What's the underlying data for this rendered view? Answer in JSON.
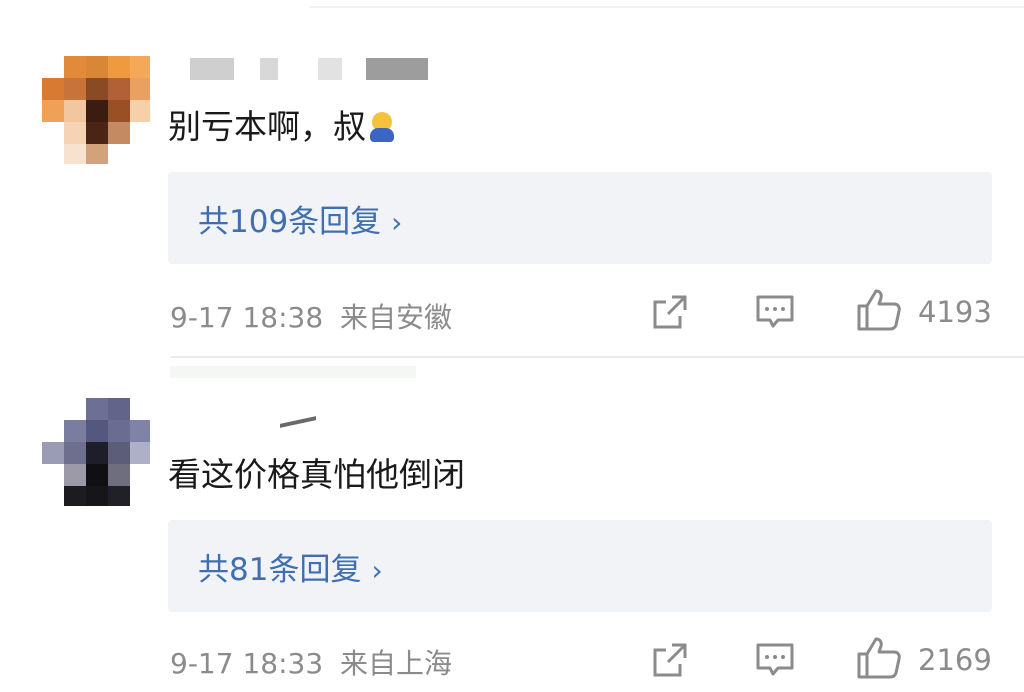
{
  "comments": [
    {
      "text": "别亏本啊，叔",
      "emoji_icon": "crying-figure-emoji",
      "replies_label": "共109条回复",
      "timestamp": "9-17 18:38",
      "location": "来自安徽",
      "likes": "4193"
    },
    {
      "text": "看这价格真怕他倒闭",
      "replies_label": "共81条回复",
      "timestamp": "9-17 18:33",
      "location": "来自上海",
      "likes": "2169"
    }
  ],
  "icons": {
    "share": "share-icon",
    "comment": "comment-icon",
    "like": "thumbs-up-icon",
    "chevron": "chevron-right-icon"
  },
  "colors": {
    "link": "#3f6fb0",
    "meta": "#8b8b8b",
    "reply_bg": "#f1f3f6"
  }
}
